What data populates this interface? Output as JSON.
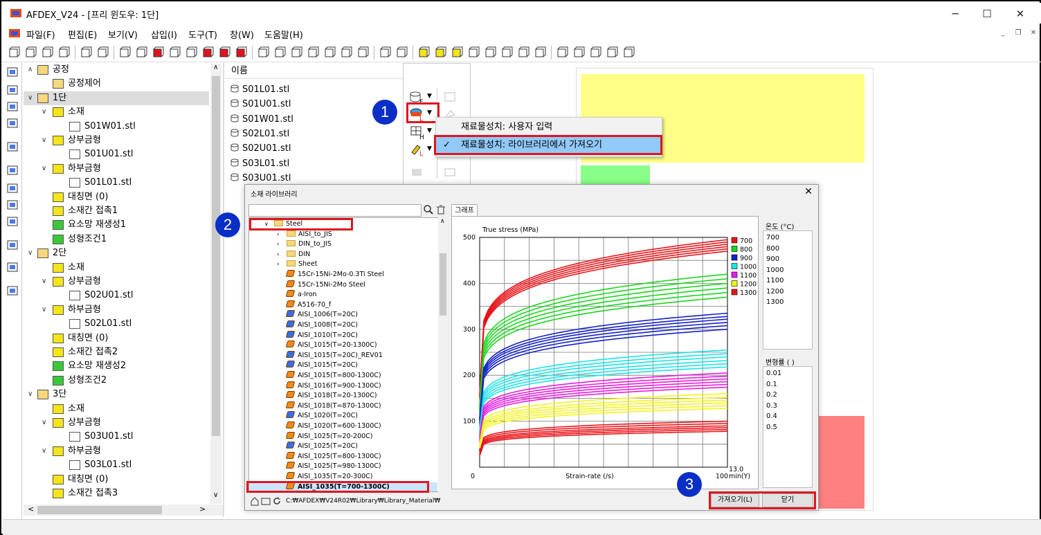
{
  "window": {
    "title": "AFDEX_V24 - [프리 윈도우: 1단]"
  },
  "menu": [
    "파일(F)",
    "편집(E)",
    "보기(V)",
    "삽입(I)",
    "도구(T)",
    "창(W)",
    "도움말(H)"
  ],
  "tree": {
    "items": [
      {
        "label": "공정",
        "level": 0,
        "chev": "∧",
        "icon": "folder"
      },
      {
        "label": "공정제어",
        "level": 1,
        "chev": "",
        "icon": "folder"
      },
      {
        "label": "1단",
        "level": 0,
        "chev": "∨",
        "icon": "folder",
        "selected": true
      },
      {
        "label": "소재",
        "level": 1,
        "chev": "∨",
        "icon": "billet"
      },
      {
        "label": "S01W01.stl",
        "level": 3,
        "chev": "",
        "icon": "stl"
      },
      {
        "label": "상부금형",
        "level": 1,
        "chev": "∨",
        "icon": "upper-die"
      },
      {
        "label": "S01U01.stl",
        "level": 3,
        "chev": "",
        "icon": "stl"
      },
      {
        "label": "하부금형",
        "level": 1,
        "chev": "∨",
        "icon": "lower-die"
      },
      {
        "label": "S01L01.stl",
        "level": 3,
        "chev": "",
        "icon": "stl"
      },
      {
        "label": "대칭면 (0)",
        "level": 2,
        "chev": "",
        "icon": "symmetry"
      },
      {
        "label": "소재간 접촉1",
        "level": 2,
        "chev": "",
        "icon": "contact"
      },
      {
        "label": "요소망 재생성1",
        "level": 2,
        "chev": "",
        "icon": "remesh"
      },
      {
        "label": "성형조건1",
        "level": 2,
        "chev": "",
        "icon": "condition"
      },
      {
        "label": "2단",
        "level": 0,
        "chev": "∨",
        "icon": "folder"
      },
      {
        "label": "소재",
        "level": 2,
        "chev": "",
        "icon": "billet"
      },
      {
        "label": "상부금형",
        "level": 1,
        "chev": "∨",
        "icon": "upper-die"
      },
      {
        "label": "S02U01.stl",
        "level": 3,
        "chev": "",
        "icon": "stl"
      },
      {
        "label": "하부금형",
        "level": 1,
        "chev": "∨",
        "icon": "lower-die"
      },
      {
        "label": "S02L01.stl",
        "level": 3,
        "chev": "",
        "icon": "stl"
      },
      {
        "label": "대칭면 (0)",
        "level": 2,
        "chev": "",
        "icon": "symmetry"
      },
      {
        "label": "소재간 접촉2",
        "level": 2,
        "chev": "",
        "icon": "contact"
      },
      {
        "label": "요소망 재생성2",
        "level": 2,
        "chev": "",
        "icon": "remesh"
      },
      {
        "label": "성형조건2",
        "level": 2,
        "chev": "",
        "icon": "condition"
      },
      {
        "label": "3단",
        "level": 0,
        "chev": "∨",
        "icon": "folder"
      },
      {
        "label": "소재",
        "level": 2,
        "chev": "",
        "icon": "billet"
      },
      {
        "label": "상부금형",
        "level": 1,
        "chev": "∨",
        "icon": "upper-die"
      },
      {
        "label": "S03U01.stl",
        "level": 3,
        "chev": "",
        "icon": "stl"
      },
      {
        "label": "하부금형",
        "level": 1,
        "chev": "∨",
        "icon": "lower-die"
      },
      {
        "label": "S03L01.stl",
        "level": 3,
        "chev": "",
        "icon": "stl"
      },
      {
        "label": "대칭면 (0)",
        "level": 2,
        "chev": "",
        "icon": "symmetry"
      },
      {
        "label": "소재간 접촉3",
        "level": 2,
        "chev": "",
        "icon": "contact"
      }
    ]
  },
  "files": {
    "header": "이름",
    "items": [
      "S01L01.stl",
      "S01U01.stl",
      "S01W01.stl",
      "S02L01.stl",
      "S02U01.stl",
      "S03L01.stl",
      "S03U01.stl"
    ]
  },
  "context_menu": {
    "items": [
      "재료물성치: 사용자 입력",
      "재료물성치: 라이브러리에서 가져오기"
    ],
    "checked_index": 1
  },
  "badges": [
    "1",
    "2",
    "3"
  ],
  "dialog": {
    "title": "소재 라이브러리",
    "tab": "그래프",
    "path": "C:₩AFDEX₩V24R02₩Library₩Library_Material₩",
    "root_folder": "Steel",
    "folders": [
      "AISI_to_JIS",
      "DIN_to_JIS",
      "DIN",
      "Sheet"
    ],
    "materials": [
      {
        "name": "15Cr-15Ni-2Mo-0.3Ti Steel",
        "color": "orange"
      },
      {
        "name": "15Cr-15Ni-2Mo Steel",
        "color": "orange"
      },
      {
        "name": "a-Iron",
        "color": "orange"
      },
      {
        "name": "A516-70_f",
        "color": "orange"
      },
      {
        "name": "AISI_1006(T=20C)",
        "color": "blue"
      },
      {
        "name": "AISI_1008(T=20C)",
        "color": "blue"
      },
      {
        "name": "AISI_1010(T=20C)",
        "color": "blue"
      },
      {
        "name": "AISI_1015(T=20-1300C)",
        "color": "orange"
      },
      {
        "name": "AISI_1015(T=20C)_REV01",
        "color": "blue"
      },
      {
        "name": "AISI_1015(T=20C)",
        "color": "blue"
      },
      {
        "name": "AISI_1015(T=800-1300C)",
        "color": "orange"
      },
      {
        "name": "AISI_1016(T=900-1300C)",
        "color": "orange"
      },
      {
        "name": "AISI_1018(T=20-1300C)",
        "color": "orange"
      },
      {
        "name": "AISI_1018(T=870-1300C)",
        "color": "orange"
      },
      {
        "name": "AISI_1020(T=20C)",
        "color": "blue"
      },
      {
        "name": "AISI_1020(T=600-1300C)",
        "color": "orange"
      },
      {
        "name": "AISI_1025(T=20-200C)",
        "color": "orange"
      },
      {
        "name": "AISI_1025(T=20C)",
        "color": "blue"
      },
      {
        "name": "AISI_1025(T=800-1300C)",
        "color": "orange"
      },
      {
        "name": "AISI_1025(T=980-1300C)",
        "color": "orange"
      },
      {
        "name": "AISI_1035(T=20-300C)",
        "color": "orange"
      },
      {
        "name": "AISI_1035(T=700-1300C)",
        "color": "orange",
        "selected": true
      }
    ],
    "temp_header": "온도 (°C)",
    "temps": [
      "700",
      "800",
      "900",
      "1000",
      "1100",
      "1200",
      "1300"
    ],
    "strain_header": "변형률 ( )",
    "strains": [
      "0.01",
      "0.1",
      "0.2",
      "0.3",
      "0.4",
      "0.5"
    ],
    "buttons": {
      "import": "가져오기(L)",
      "close": "닫기"
    }
  },
  "colors": {
    "700": "#e8141a",
    "800": "#16d81a",
    "900": "#1420c8",
    "1000": "#1ae4e8",
    "1100": "#e81ae4",
    "1200": "#f4f41a",
    "1300": "#e8141a",
    "annotation": "#e0141e",
    "badge": "#0a2fc7"
  },
  "chart_data": {
    "type": "line",
    "title": "True stress (MPa)",
    "xlabel": "Strain-rate (/s)",
    "ylabel": "True stress (MPa)",
    "x_ticks": [
      "0",
      "100"
    ],
    "y_ticks": [
      "100",
      "200",
      "300",
      "400",
      "500"
    ],
    "ylim": [
      0,
      500
    ],
    "xlim": [
      0,
      100
    ],
    "annotation": "13.0 min(Y)",
    "legend": [
      "700",
      "800",
      "900",
      "1000",
      "1100",
      "1200",
      "1300"
    ],
    "series": [
      {
        "name": "700",
        "at_100": [
          495,
          490,
          485,
          480,
          475,
          470
        ]
      },
      {
        "name": "800",
        "at_100": [
          420,
          410,
          400,
          390,
          380,
          370
        ]
      },
      {
        "name": "900",
        "at_100": [
          335,
          328,
          322,
          315,
          308,
          300
        ]
      },
      {
        "name": "1000",
        "at_100": [
          255,
          247,
          240,
          232,
          225,
          218
        ]
      },
      {
        "name": "1100",
        "at_100": [
          205,
          198,
          192,
          186,
          180,
          174
        ]
      },
      {
        "name": "1200",
        "at_100": [
          160,
          152,
          146,
          140,
          134,
          128
        ]
      },
      {
        "name": "1300",
        "at_100": [
          100,
          95,
          90,
          86,
          82,
          78
        ]
      }
    ]
  }
}
